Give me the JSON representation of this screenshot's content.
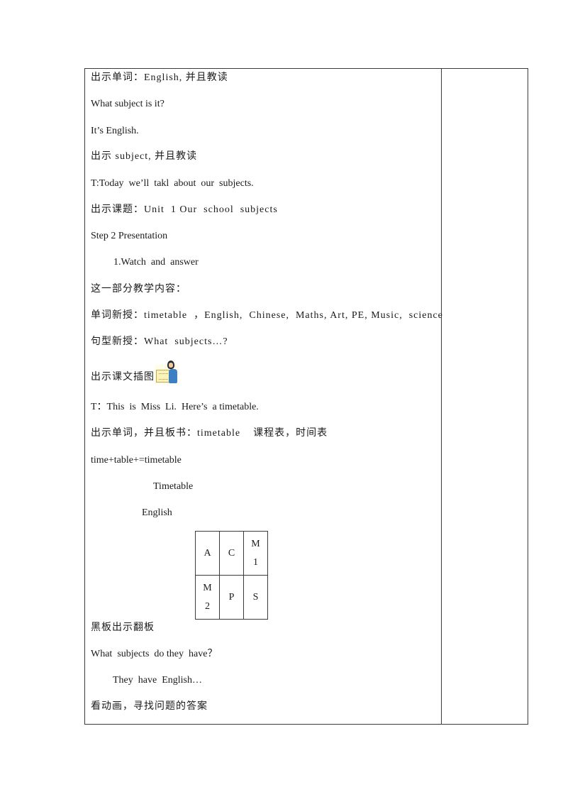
{
  "lines": [
    "出示单词：English, 并且教读",
    "What subject is it?",
    "It’s English.",
    "出示 subject, 并且教读",
    "T:Today  we’ll  takl  about  our  subjects.",
    "出示课题：Unit  1 Our  school  subjects",
    "Step 2 Presentation",
    "1.Watch  and  answer",
    "这一部分教学内容：",
    "单词新授：timetable  ，English,  Chinese,  Maths, Art, PE, Music,  science",
    "句型新授：What  subjects…?",
    "出示课文插图",
    "T：This  is  Miss  Li.  Here’s  a timetable.",
    "出示单词，并且板书：timetable    课程表，时间表",
    "time+table+=timetable",
    "Timetable",
    "English",
    "黑板出示翻板",
    "What  subjects  do they  have？",
    "They  have  English…",
    "看动画，寻找问题的答案"
  ],
  "illustration": {
    "icon": "teacher-with-timetable-icon"
  },
  "flip_board": {
    "rows": [
      [
        {
          "top": "A",
          "bottom": ""
        },
        {
          "top": "C",
          "bottom": ""
        },
        {
          "top": "M",
          "bottom": "1"
        }
      ],
      [
        {
          "top": "M",
          "bottom": "2"
        },
        {
          "top": "P",
          "bottom": ""
        },
        {
          "top": "S",
          "bottom": ""
        }
      ]
    ]
  }
}
